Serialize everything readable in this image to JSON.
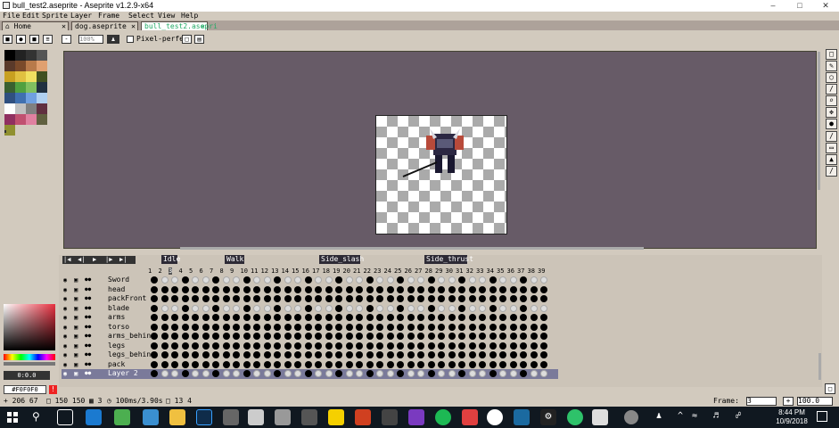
{
  "window": {
    "title": "bull_test2.aseprite - Aseprite v1.2.9-x64"
  },
  "menu": [
    "File",
    "Edit",
    "Sprite",
    "Layer",
    "Frame",
    "Select",
    "View",
    "Help"
  ],
  "tabs": [
    {
      "label": "Home",
      "icon": "home-icon"
    },
    {
      "label": "dog.aseprite"
    },
    {
      "label": "bull_test2.asepri",
      "active": true
    }
  ],
  "toolbar": {
    "zoom_value": "100%",
    "pixel_perfect": "Pixel-perfect"
  },
  "color": {
    "hex": "#F0F0F0",
    "index": "0:0.0"
  },
  "tags": [
    "Idle",
    "Walk",
    "Side_slash",
    "Side_thrust"
  ],
  "frames": [
    "1",
    "2",
    "3",
    "4",
    "5",
    "6",
    "7",
    "8",
    "9",
    "10",
    "11",
    "12",
    "13",
    "14",
    "15",
    "16",
    "17",
    "18",
    "19",
    "20",
    "21",
    "22",
    "23",
    "24",
    "25",
    "26",
    "27",
    "28",
    "29",
    "30",
    "31",
    "32",
    "33",
    "34",
    "35",
    "36",
    "37",
    "38",
    "39"
  ],
  "layers": [
    "Sword",
    "head",
    "packFront",
    "blade",
    "arms",
    "torso",
    "arms_behin",
    "legs",
    "legs_behind",
    "pack",
    "Layer 2"
  ],
  "status": {
    "pos": "206 67",
    "size1": "150 150",
    "frame_info": "3",
    "duration": "100ms/3.90s",
    "extra": "13 4",
    "frame_label": "Frame:",
    "frame_value": "3",
    "zoom": "100.0"
  },
  "clock": {
    "time": "8:44 PM",
    "date": "10/9/2018"
  }
}
